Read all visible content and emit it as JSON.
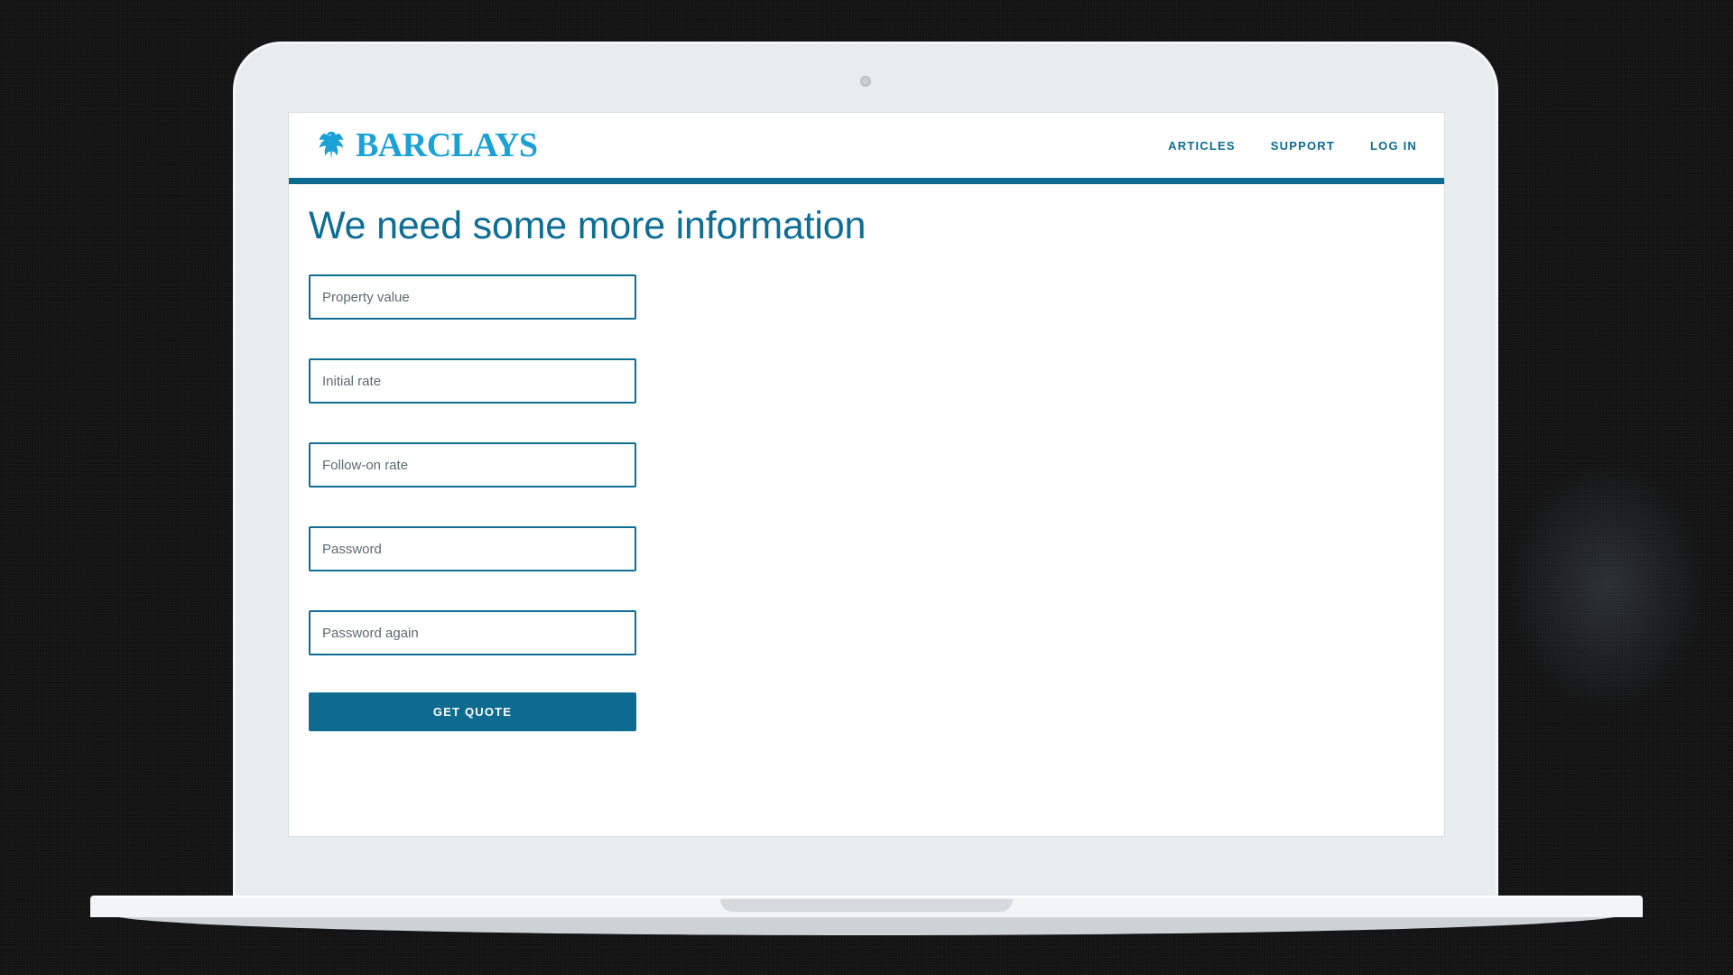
{
  "brand": {
    "name": "BARCLAYS",
    "color": "#1aa1d6",
    "icon": "eagle-icon"
  },
  "nav": {
    "items": [
      {
        "label": "ARTICLES"
      },
      {
        "label": "SUPPORT"
      },
      {
        "label": "LOG IN"
      }
    ]
  },
  "page": {
    "title": "We need some more information",
    "accent_color": "#0d6b8f"
  },
  "form": {
    "fields": [
      {
        "placeholder": "Property value",
        "value": ""
      },
      {
        "placeholder": "Initial rate",
        "value": ""
      },
      {
        "placeholder": "Follow-on rate",
        "value": ""
      },
      {
        "placeholder": "Password",
        "value": ""
      },
      {
        "placeholder": "Password again",
        "value": ""
      }
    ],
    "submit_label": "GET QUOTE"
  }
}
